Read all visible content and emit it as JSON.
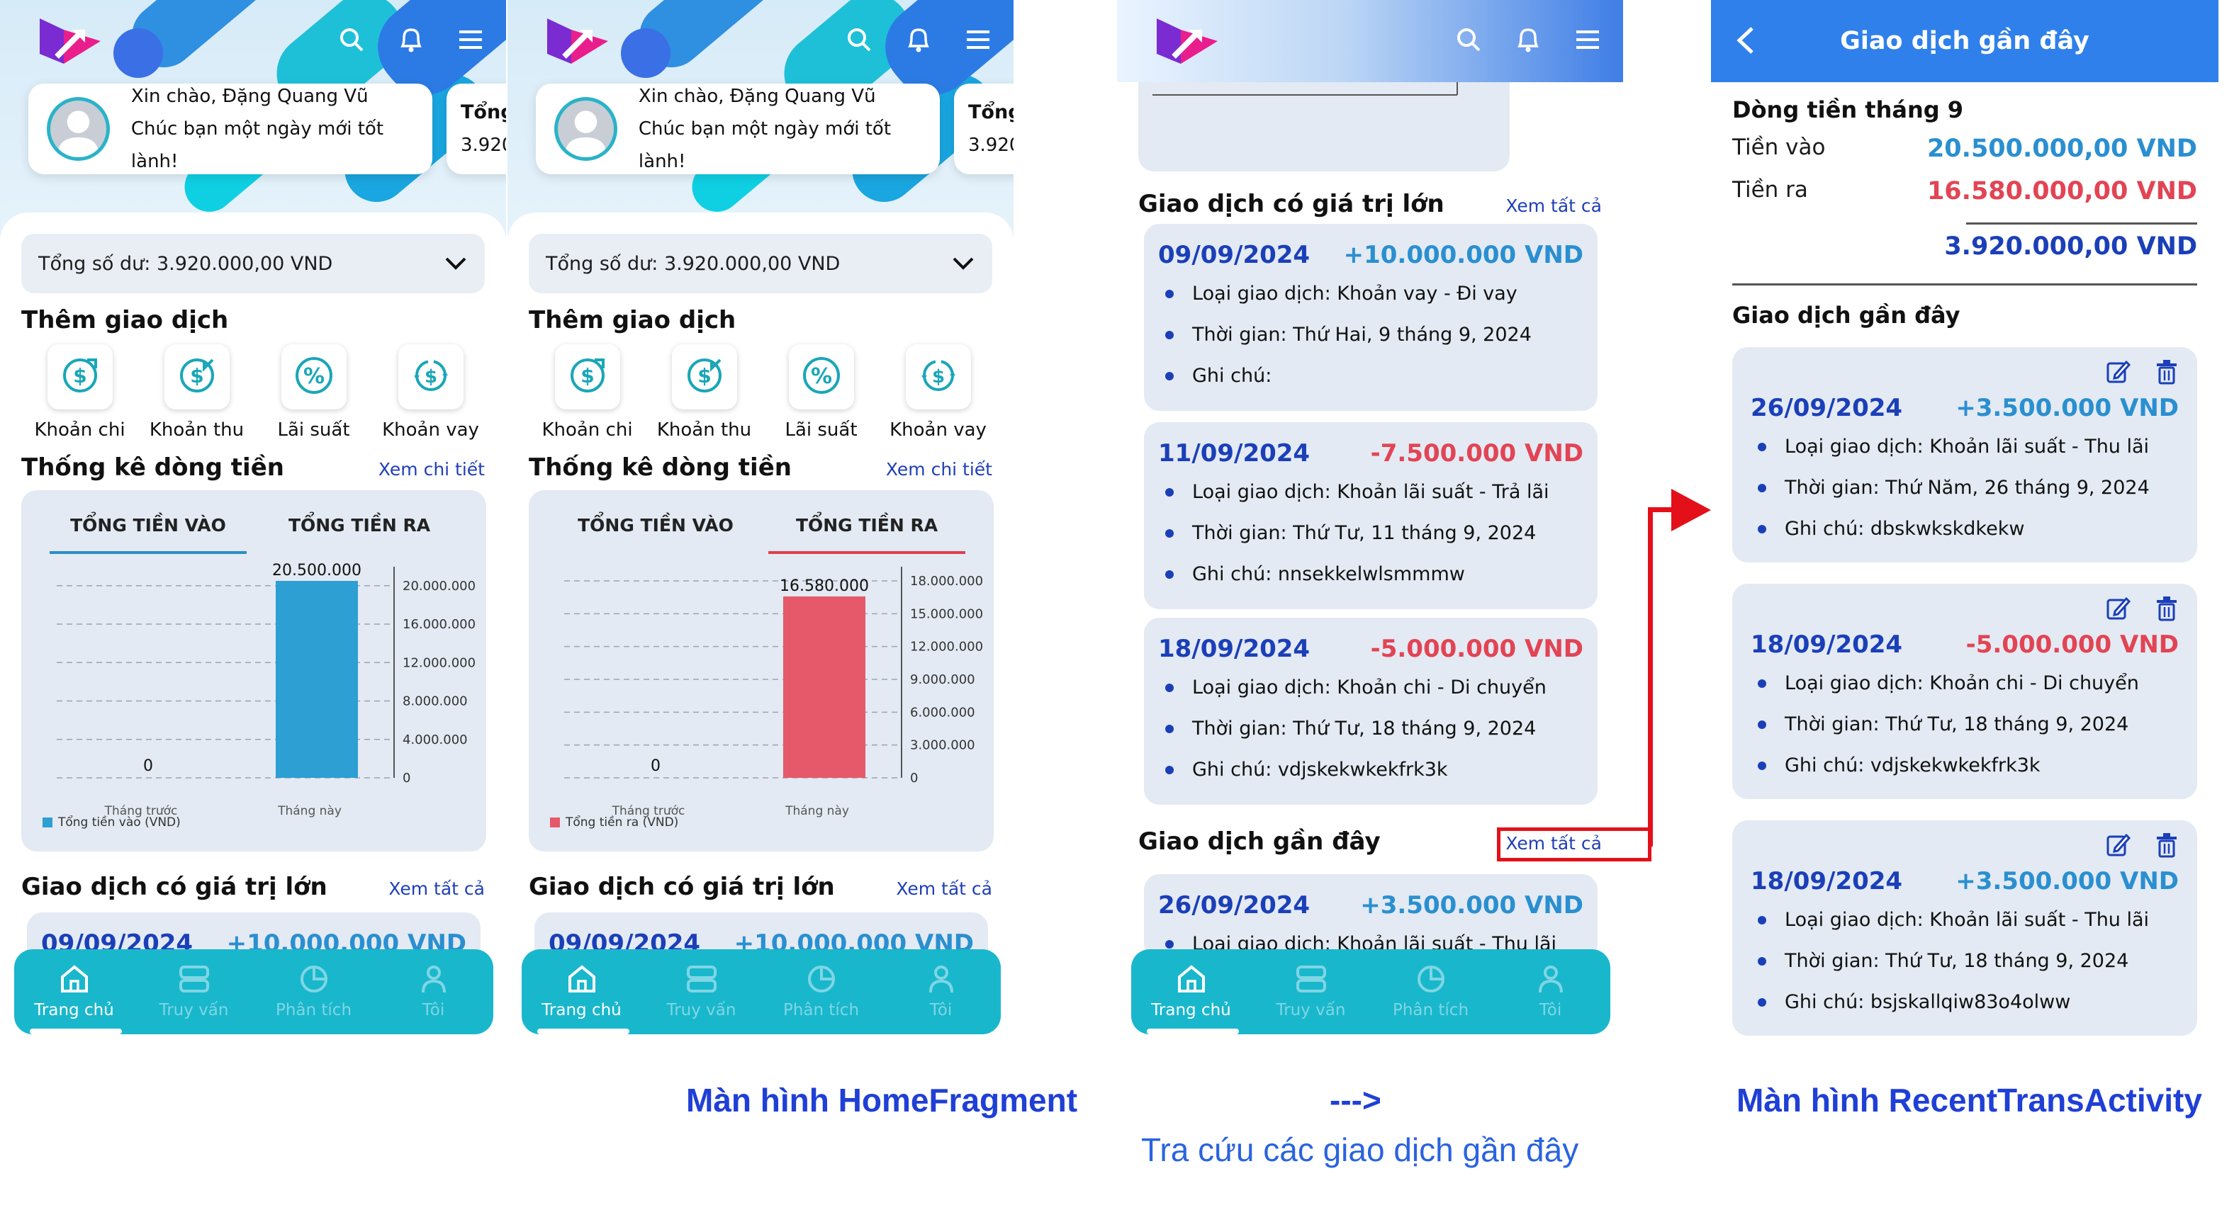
{
  "home": {
    "greeting": "Xin chào, Đặng Quang Vũ",
    "greeting_sub": "Chúc bạn một ngày mới tốt lành!",
    "second_card_title": "Tổng",
    "second_card_value": "3.920",
    "balance": "Tổng số dư: 3.920.000,00 VND",
    "add_tx_title": "Thêm giao dịch",
    "actions": [
      {
        "label": "Khoản chi",
        "icon": "expense-icon"
      },
      {
        "label": "Khoản thu",
        "icon": "income-icon"
      },
      {
        "label": "Lãi suất",
        "icon": "interest-icon"
      },
      {
        "label": "Khoản vay",
        "icon": "loan-icon"
      }
    ],
    "cashflow_title": "Thống kê dòng tiền",
    "cashflow_link": "Xem chi tiết",
    "tab_in": "TỔNG TIỀN VÀO",
    "tab_out": "TỔNG TIỀN RA",
    "large_tx_title": "Giao dịch có giá trị lớn",
    "see_all": "Xem tất cả",
    "recent_title": "Giao dịch gần đây"
  },
  "chart_data": [
    {
      "type": "bar",
      "categories": [
        "Tháng trước",
        "Tháng này"
      ],
      "series": [
        {
          "name": "Tổng tiền vào (VND)",
          "values": [
            0,
            20500000
          ],
          "color": "#2d9fd3"
        }
      ],
      "value_labels": [
        "0",
        "20.500.000"
      ],
      "yticks": [
        "0",
        "4.000.000",
        "8.000.000",
        "12.000.000",
        "16.000.000",
        "20.000.000"
      ],
      "ylim": [
        0,
        20500000
      ],
      "legend": "bottom-left"
    },
    {
      "type": "bar",
      "categories": [
        "Tháng trước",
        "Tháng này"
      ],
      "series": [
        {
          "name": "Tổng tiền ra (VND)",
          "values": [
            0,
            16580000
          ],
          "color": "#e6596a"
        }
      ],
      "value_labels": [
        "0",
        "16.580.000"
      ],
      "yticks": [
        "0",
        "3.000.000",
        "6.000.000",
        "9.000.000",
        "12.000.000",
        "15.000.000",
        "18.000.000"
      ],
      "ylim": [
        0,
        18000000
      ],
      "legend": "bottom-left"
    }
  ],
  "large_tx": [
    {
      "date": "09/09/2024",
      "amount": "+10.000.000 VND",
      "sign": "pos",
      "type": "Loại giao dịch: Khoản vay - Đi vay",
      "time": "Thời gian: Thứ Hai, 9 tháng 9, 2024",
      "note": "Ghi chú:"
    },
    {
      "date": "11/09/2024",
      "amount": "-7.500.000 VND",
      "sign": "neg",
      "type": "Loại giao dịch: Khoản lãi suất - Trả lãi",
      "time": "Thời gian: Thứ Tư, 11 tháng 9, 2024",
      "note": "Ghi chú: nnsekkelwlsmmmw"
    },
    {
      "date": "18/09/2024",
      "amount": "-5.000.000 VND",
      "sign": "neg",
      "type": "Loại giao dịch: Khoản chi - Di chuyển",
      "time": "Thời gian: Thứ Tư, 18 tháng 9, 2024",
      "note": "Ghi chú: vdjskekwkekfrk3k"
    }
  ],
  "recent_preview": {
    "date": "26/09/2024",
    "amount": "+3.500.000 VND",
    "type": "Loại giao dịch: Khoản lãi suất - Thu lãi"
  },
  "nav": [
    "Trang chủ",
    "Truy vấn",
    "Phân tích",
    "Tôi"
  ],
  "recent_screen": {
    "title": "Giao dịch gần đây",
    "flow_title": "Dòng tiền tháng 9",
    "in_label": "Tiền vào",
    "in_value": "20.500.000,00 VND",
    "out_label": "Tiền ra",
    "out_value": "16.580.000,00 VND",
    "net_value": "3.920.000,00 VND",
    "list_title": "Giao dịch gần đây",
    "items": [
      {
        "date": "26/09/2024",
        "amount": "+3.500.000 VND",
        "sign": "pos",
        "type": "Loại giao dịch: Khoản lãi suất - Thu lãi",
        "time": "Thời gian: Thứ Năm, 26 tháng 9, 2024",
        "note": "Ghi chú: dbskwkskdkekw"
      },
      {
        "date": "18/09/2024",
        "amount": "-5.000.000 VND",
        "sign": "neg",
        "type": "Loại giao dịch: Khoản chi - Di chuyển",
        "time": "Thời gian: Thứ Tư, 18 tháng 9, 2024",
        "note": "Ghi chú: vdjskekwkekfrk3k"
      },
      {
        "date": "18/09/2024",
        "amount": "+3.500.000 VND",
        "sign": "pos",
        "type": "Loại giao dịch: Khoản lãi suất - Thu lãi",
        "time": "Thời gian: Thứ Tư, 18 tháng 9, 2024",
        "note": "Ghi chú: bsjskallqiw83o4olww"
      }
    ]
  },
  "captions": {
    "home": "Màn hình HomeFragment",
    "arrow": "--->",
    "lookup": "Tra cứu các giao dịch gần đây",
    "recent": "Màn hình RecentTransActivity"
  },
  "colors": {
    "primary": "#1b3fb8",
    "teal": "#19b7cc",
    "positive": "#2a8fd0",
    "negative": "#e24454",
    "highlight": "#e3101a"
  }
}
